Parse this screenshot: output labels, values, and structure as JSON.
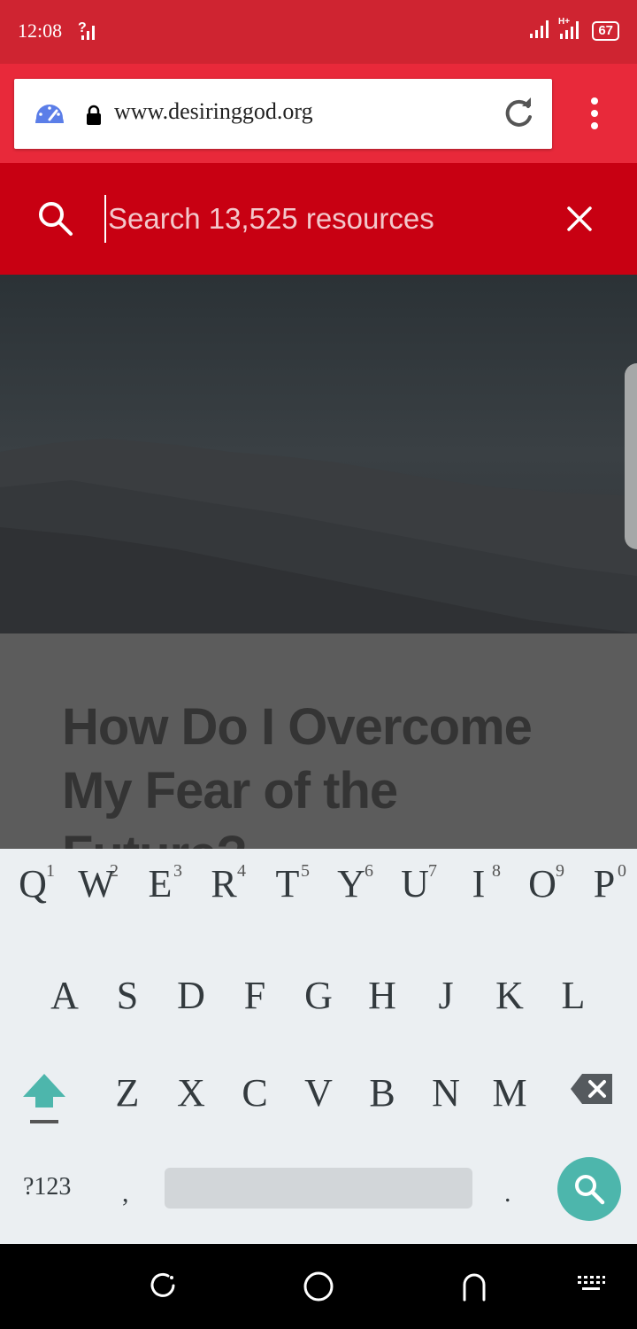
{
  "status_bar": {
    "time": "12:08",
    "battery": "67",
    "network_label": "H+"
  },
  "browser": {
    "url": "www.desiringgod.org"
  },
  "search": {
    "placeholder": "Search 13,525 resources"
  },
  "article": {
    "title": "How Do I Overcome My Fear of the Future?"
  },
  "keyboard": {
    "row1": [
      {
        "letter": "Q",
        "num": "1"
      },
      {
        "letter": "W",
        "num": "2"
      },
      {
        "letter": "E",
        "num": "3"
      },
      {
        "letter": "R",
        "num": "4"
      },
      {
        "letter": "T",
        "num": "5"
      },
      {
        "letter": "Y",
        "num": "6"
      },
      {
        "letter": "U",
        "num": "7"
      },
      {
        "letter": "I",
        "num": "8"
      },
      {
        "letter": "O",
        "num": "9"
      },
      {
        "letter": "P",
        "num": "0"
      }
    ],
    "row2": [
      "A",
      "S",
      "D",
      "F",
      "G",
      "H",
      "J",
      "K",
      "L"
    ],
    "row3": [
      "Z",
      "X",
      "C",
      "V",
      "B",
      "N",
      "M"
    ],
    "symbols_label": "?123",
    "comma": ",",
    "period": ".",
    "accent_color": "#4db6ac"
  },
  "colors": {
    "status_bar": "#cf2431",
    "browser_bar": "#e8293a",
    "search_bar": "#c80012"
  }
}
